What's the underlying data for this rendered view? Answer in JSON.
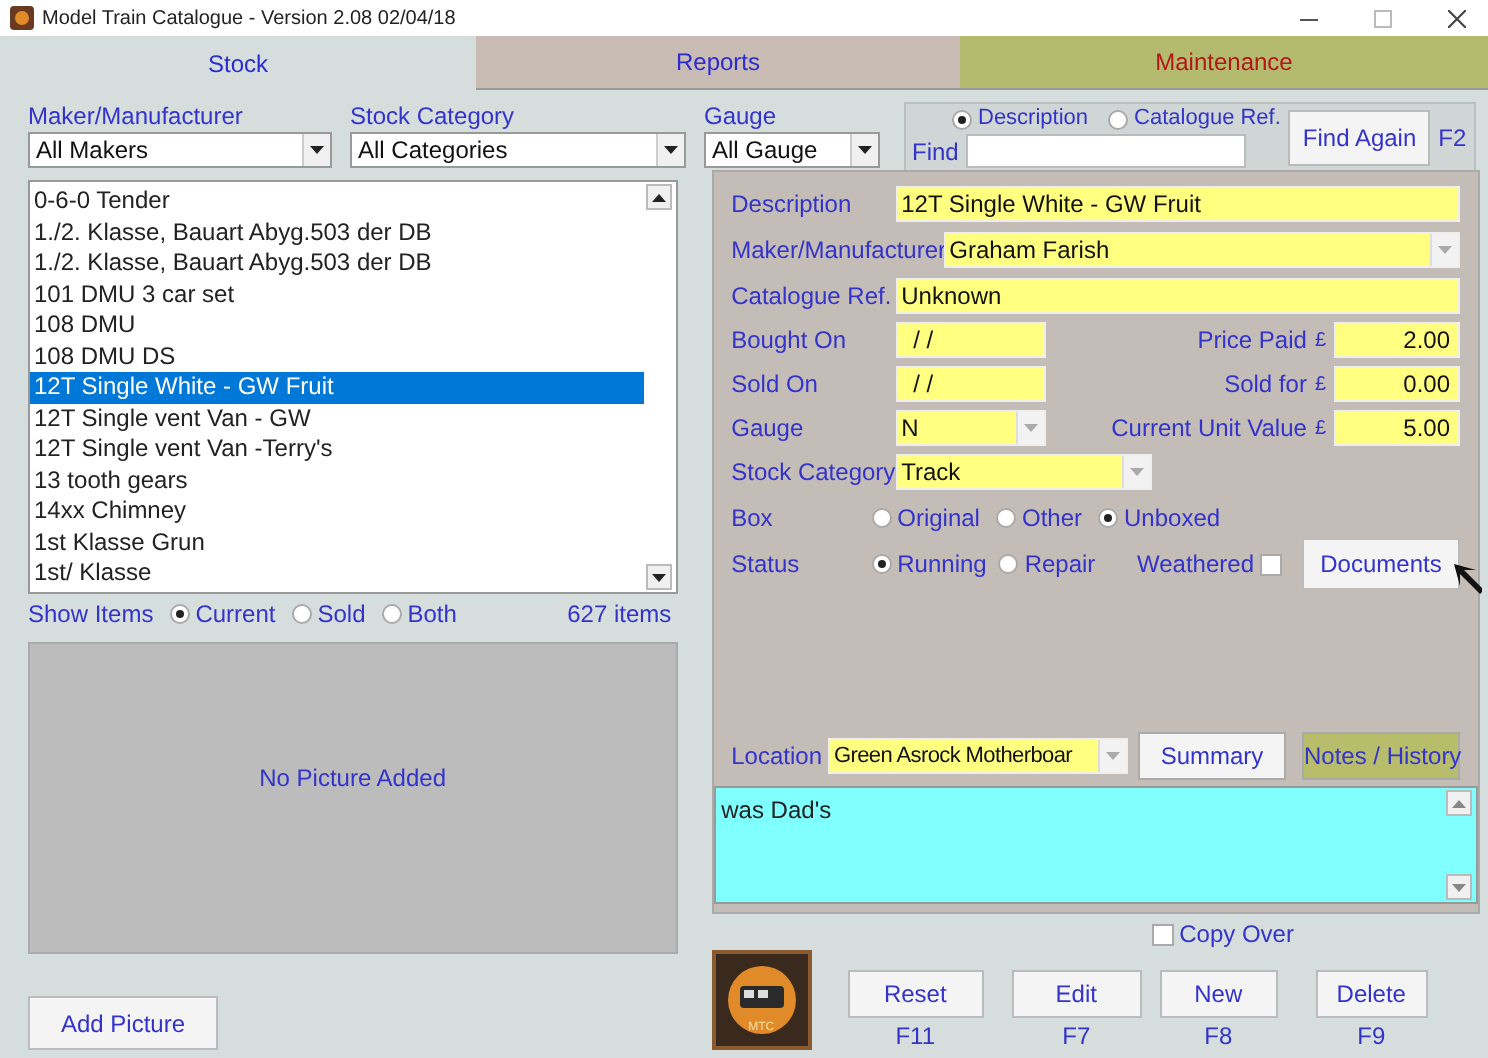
{
  "window": {
    "title": "Model Train Catalogue - Version 2.08  02/04/18"
  },
  "tabs": [
    {
      "label": "Stock",
      "selected": true,
      "color": "#d6dedd"
    },
    {
      "label": "Reports",
      "selected": false,
      "color": "#c9bcb4"
    },
    {
      "label": "Maintenance",
      "selected": false,
      "color": "#b4bb6e"
    }
  ],
  "filters": [
    {
      "label": "Maker/Manufacturer",
      "value": "All Makers"
    },
    {
      "label": "Stock Category",
      "value": "All Categories"
    },
    {
      "label": "Gauge",
      "value": "All Gauge"
    }
  ],
  "find": {
    "options": [
      {
        "label": "Description",
        "selected": true
      },
      {
        "label": "Catalogue Ref.",
        "selected": false
      }
    ],
    "label": "Find",
    "button": "Find Again",
    "shortcut": "F2"
  },
  "stock_list": {
    "items": [
      {
        "text": "0-6-0 Tender",
        "selected": false
      },
      {
        "text": "1./2. Klasse, Bauart Abyg.503 der DB",
        "selected": false
      },
      {
        "text": "1./2. Klasse, Bauart Abyg.503 der DB",
        "selected": false
      },
      {
        "text": "101 DMU 3 car set",
        "selected": false
      },
      {
        "text": "108 DMU",
        "selected": false
      },
      {
        "text": "108 DMU DS",
        "selected": false
      },
      {
        "text": "12T Single White - GW Fruit",
        "selected": true
      },
      {
        "text": "12T Single vent Van - GW",
        "selected": false
      },
      {
        "text": "12T Single vent Van -Terry's",
        "selected": false
      },
      {
        "text": "13 tooth gears",
        "selected": false
      },
      {
        "text": "14xx Chimney",
        "selected": false
      },
      {
        "text": "1st Klasse Grun",
        "selected": false
      },
      {
        "text": "1st/ Klasse",
        "selected": false
      }
    ],
    "show_items": {
      "label": "Show Items",
      "options": [
        {
          "label": "Current",
          "selected": true
        },
        {
          "label": "Sold",
          "selected": false
        },
        {
          "label": "Both",
          "selected": false
        }
      ]
    },
    "count": "627 items"
  },
  "picture": {
    "placeholder": "No Picture Added",
    "button": "Add Picture"
  },
  "details": {
    "description": {
      "label": "Description",
      "value": "12T Single White - GW Fruit"
    },
    "maker": {
      "label": "Maker/Manufacturer",
      "value": "Graham Farish"
    },
    "catalogue_ref": {
      "label": "Catalogue Ref.",
      "value": "Unknown"
    },
    "bought_on": {
      "label": "Bought On",
      "value": "/ /"
    },
    "sold_on": {
      "label": "Sold On",
      "value": "/ /"
    },
    "gauge": {
      "label": "Gauge",
      "value": "N"
    },
    "stock_category": {
      "label": "Stock Category",
      "value": "Track"
    },
    "price_paid": {
      "label": "Price Paid",
      "currency": "£",
      "value": "2.00"
    },
    "sold_for": {
      "label": "Sold for",
      "currency": "£",
      "value": "0.00"
    },
    "current_unit_value": {
      "label": "Current Unit Value",
      "currency": "£",
      "value": "5.00"
    },
    "box": {
      "label": "Box",
      "options": [
        {
          "label": "Original",
          "selected": false
        },
        {
          "label": "Other",
          "selected": false
        },
        {
          "label": "Unboxed",
          "selected": true
        }
      ]
    },
    "status": {
      "label": "Status",
      "options": [
        {
          "label": "Running",
          "selected": true
        },
        {
          "label": "Repair",
          "selected": false
        }
      ]
    },
    "weathered": {
      "label": "Weathered",
      "checked": false
    },
    "documents_button": "Documents",
    "location": {
      "label": "Location",
      "value": "Green Asrock Motherboar"
    },
    "panel_buttons": [
      {
        "label": "Summary",
        "selected": false
      },
      {
        "label": "Notes / History",
        "selected": true
      }
    ],
    "notes": "was Dad's"
  },
  "actions": {
    "logo_text": "MTC",
    "copy_over": {
      "label": "Copy Over",
      "checked": false
    },
    "buttons": [
      {
        "label": "Reset",
        "shortcut": "F11"
      },
      {
        "label": "Edit",
        "shortcut": "F7"
      },
      {
        "label": "New",
        "shortcut": "F8"
      },
      {
        "label": "Delete",
        "shortcut": "F9"
      }
    ]
  }
}
